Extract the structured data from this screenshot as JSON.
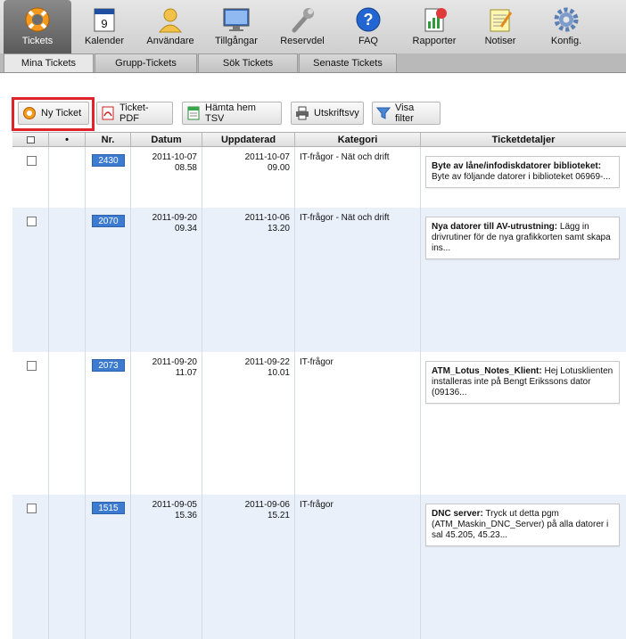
{
  "nav": [
    {
      "label": "Tickets",
      "icon": "lifebuoy-icon",
      "active": true
    },
    {
      "label": "Kalender",
      "icon": "calendar-icon",
      "day": "9"
    },
    {
      "label": "Användare",
      "icon": "user-icon"
    },
    {
      "label": "Tillgångar",
      "icon": "monitor-icon"
    },
    {
      "label": "Reservdel",
      "icon": "wrench-icon"
    },
    {
      "label": "FAQ",
      "icon": "question-icon"
    },
    {
      "label": "Rapporter",
      "icon": "report-icon"
    },
    {
      "label": "Notiser",
      "icon": "notepad-icon"
    },
    {
      "label": "Konfig.",
      "icon": "gear-icon"
    }
  ],
  "subtabs": [
    "Mina Tickets",
    "Grupp-Tickets",
    "Sök Tickets",
    "Senaste Tickets"
  ],
  "toolbar": {
    "new_ticket": "Ny Ticket",
    "ticket_pdf": "Ticket-PDF",
    "fetch_tsv": "Hämta hem TSV",
    "print_view": "Utskriftsvy",
    "show_filter": "Visa filter"
  },
  "table": {
    "headers": [
      "",
      "•",
      "Nr.",
      "Datum",
      "Uppdaterad",
      "Kategori",
      "Ticketdetaljer"
    ],
    "rows": [
      {
        "nr": "2430",
        "date": "2011-10-07",
        "time": "08.58",
        "updated_date": "2011-10-07",
        "updated_time": "09.00",
        "category": "IT-frågor - Nät och drift",
        "title": "Byte av låne/infodiskdatorer biblioteket:",
        "desc": "Byte av följande datorer i biblioteket 06969-..."
      },
      {
        "nr": "2070",
        "date": "2011-09-20",
        "time": "09.34",
        "updated_date": "2011-10-06",
        "updated_time": "13.20",
        "category": "IT-frågor - Nät och drift",
        "title": "Nya datorer till AV-utrustning:",
        "desc": "Lägg in drivrutiner för de nya grafikkorten samt skapa ins..."
      },
      {
        "nr": "2073",
        "date": "2011-09-20",
        "time": "11.07",
        "updated_date": "2011-09-22",
        "updated_time": "10.01",
        "category": "IT-frågor",
        "title": "ATM_Lotus_Notes_Klient:",
        "desc": "Hej Lotusklienten installeras inte på Bengt Erikssons dator (09136..."
      },
      {
        "nr": "1515",
        "date": "2011-09-05",
        "time": "15.36",
        "updated_date": "2011-09-06",
        "updated_time": "15.21",
        "category": "IT-frågor",
        "title": "DNC server:",
        "desc": "Tryck ut detta pgm (ATM_Maskin_DNC_Server) på alla datorer i sal 45.205, 45.23..."
      }
    ]
  },
  "colors": {
    "badge": "#3d7bd0",
    "row_alt": "#e9f0fa",
    "highlight": "#e0232a"
  }
}
